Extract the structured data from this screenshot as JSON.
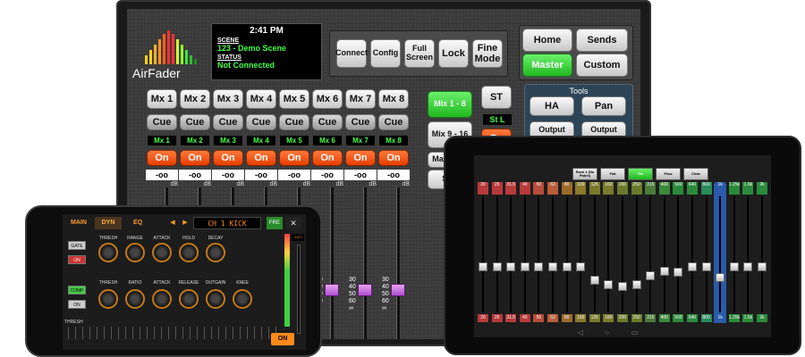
{
  "monitor": {
    "logo_text": "AirFader",
    "time": "2:41 PM",
    "scene_label": "SCENE",
    "scene_value": "123 - Demo Scene",
    "status_label": "STATUS",
    "status_value": "Not Connected",
    "toolbar": [
      {
        "id": "connect",
        "label": "Connect"
      },
      {
        "id": "config",
        "label": "Config"
      },
      {
        "id": "fullscreen",
        "label": "Full Screen"
      },
      {
        "id": "lock",
        "label": "Lock"
      },
      {
        "id": "finemode",
        "label": "Fine Mode"
      }
    ],
    "nav": [
      {
        "id": "home",
        "label": "Home",
        "active": false
      },
      {
        "id": "sends",
        "label": "Sends",
        "active": false
      },
      {
        "id": "master",
        "label": "Master",
        "active": true
      },
      {
        "id": "custom",
        "label": "Custom",
        "active": false
      }
    ],
    "mix_buttons": [
      "Mx 1",
      "Mx 2",
      "Mx 3",
      "Mx 4",
      "Mx 5",
      "Mx 6",
      "Mx 7",
      "Mx 8"
    ],
    "cue_label": "Cue",
    "mix_labels": [
      "Mx 1",
      "Mx 2",
      "Mx 3",
      "Mx 4",
      "Mx 5",
      "Mx 6",
      "Mx 7",
      "Mx 8"
    ],
    "on_label": "On",
    "strip_value": "-oo",
    "db_label": "dB",
    "mix_banks": [
      {
        "id": "mix1-8",
        "label": "Mix 1 - 8",
        "active": true
      },
      {
        "id": "mix9-16",
        "label": "Mix 9 - 16",
        "active": false
      },
      {
        "id": "matrix",
        "label": "Matrix 1 -",
        "active": false
      },
      {
        "id": "stereo",
        "label": "Ster",
        "active": false
      }
    ],
    "st_button": "ST",
    "st_label": "St L",
    "st_on": "On",
    "tools_title": "Tools",
    "tools": [
      "HA",
      "Pan",
      "Output",
      "Output"
    ],
    "scale": [
      "30",
      "40",
      "50",
      "60",
      "∞"
    ]
  },
  "phone": {
    "tabs": [
      "MAIN",
      "DYN",
      "EQ"
    ],
    "active_tab": "DYN",
    "channel_display": "CH 1 KICK",
    "fre_label": "FRE",
    "close_label": "✕",
    "gate_label": "GATE",
    "gate_on": "ON",
    "comp_label": "COMP",
    "comp_on": "ON",
    "gate_knobs": [
      "THRESH",
      "RANGE",
      "ATTACK",
      "HOLD",
      "DECAY"
    ],
    "comp_knobs": [
      "THRESH",
      "RATIO",
      "ATTACK",
      "RELEASE",
      "OUTGAIN",
      "KNEE"
    ],
    "thresh_label": "THRESH",
    "meter_top": "-14.0",
    "on_button": "ON"
  },
  "tablet": {
    "top_buttons": [
      {
        "label": "Rack 1 (No Patch)",
        "active": false
      },
      {
        "label": "Flat",
        "active": false
      },
      {
        "label": "On",
        "active": true
      },
      {
        "label": "Flow",
        "active": false
      },
      {
        "label": "Clear",
        "active": false
      }
    ],
    "frequencies": [
      "20",
      "25",
      "31.5",
      "40",
      "50",
      "63",
      "80",
      "100",
      "125",
      "160",
      "200",
      "250",
      "315",
      "400",
      "500",
      "640",
      "800",
      "1k",
      "1.25k",
      "1.6k",
      "2k"
    ],
    "freq_colors": [
      "#b83a3a",
      "#b83a3a",
      "#b83a3a",
      "#b83a3a",
      "#b84c3a",
      "#b85c3a",
      "#9a6a2a",
      "#8a7a2a",
      "#7a7a2a",
      "#7a7a2a",
      "#6a7a2a",
      "#6a7a2a",
      "#4a7a3a",
      "#3a8a3a",
      "#2a8a3a",
      "#2a8a3a",
      "#2a8a5a",
      "#2a5aaa",
      "#2a8a3a",
      "#2a8a3a",
      "#2a8a3a"
    ],
    "selected_band": "1k"
  }
}
